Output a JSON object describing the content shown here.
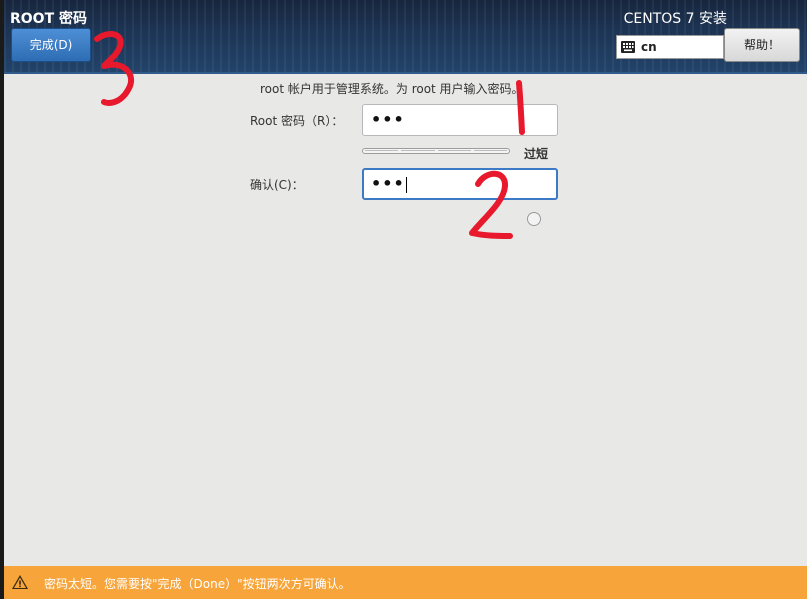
{
  "header": {
    "title": "ROOT 密码",
    "done_label": "完成(D)",
    "product": "CENTOS 7 安装",
    "keyboard_layout": "cn",
    "help_label": "帮助！"
  },
  "form": {
    "description": "root 帐户用于管理系统。为 root 用户输入密码。",
    "root_label": "Root 密码（R）：",
    "root_value": "•••",
    "confirm_label": "确认(C)：",
    "confirm_value": "•••",
    "strength_text": "过短",
    "strength_level": 0
  },
  "warning": {
    "text": "密码太短。您需要按\"完成（Done）\"按钮两次方可确认。"
  },
  "annotations": [
    "1",
    "2",
    "3"
  ],
  "colors": {
    "header_bg": "#1d3555",
    "done_button": "#2e6db3",
    "warning_bar": "#f7a53b",
    "annotation": "#e8192c",
    "focus_border": "#3d7ac6"
  }
}
